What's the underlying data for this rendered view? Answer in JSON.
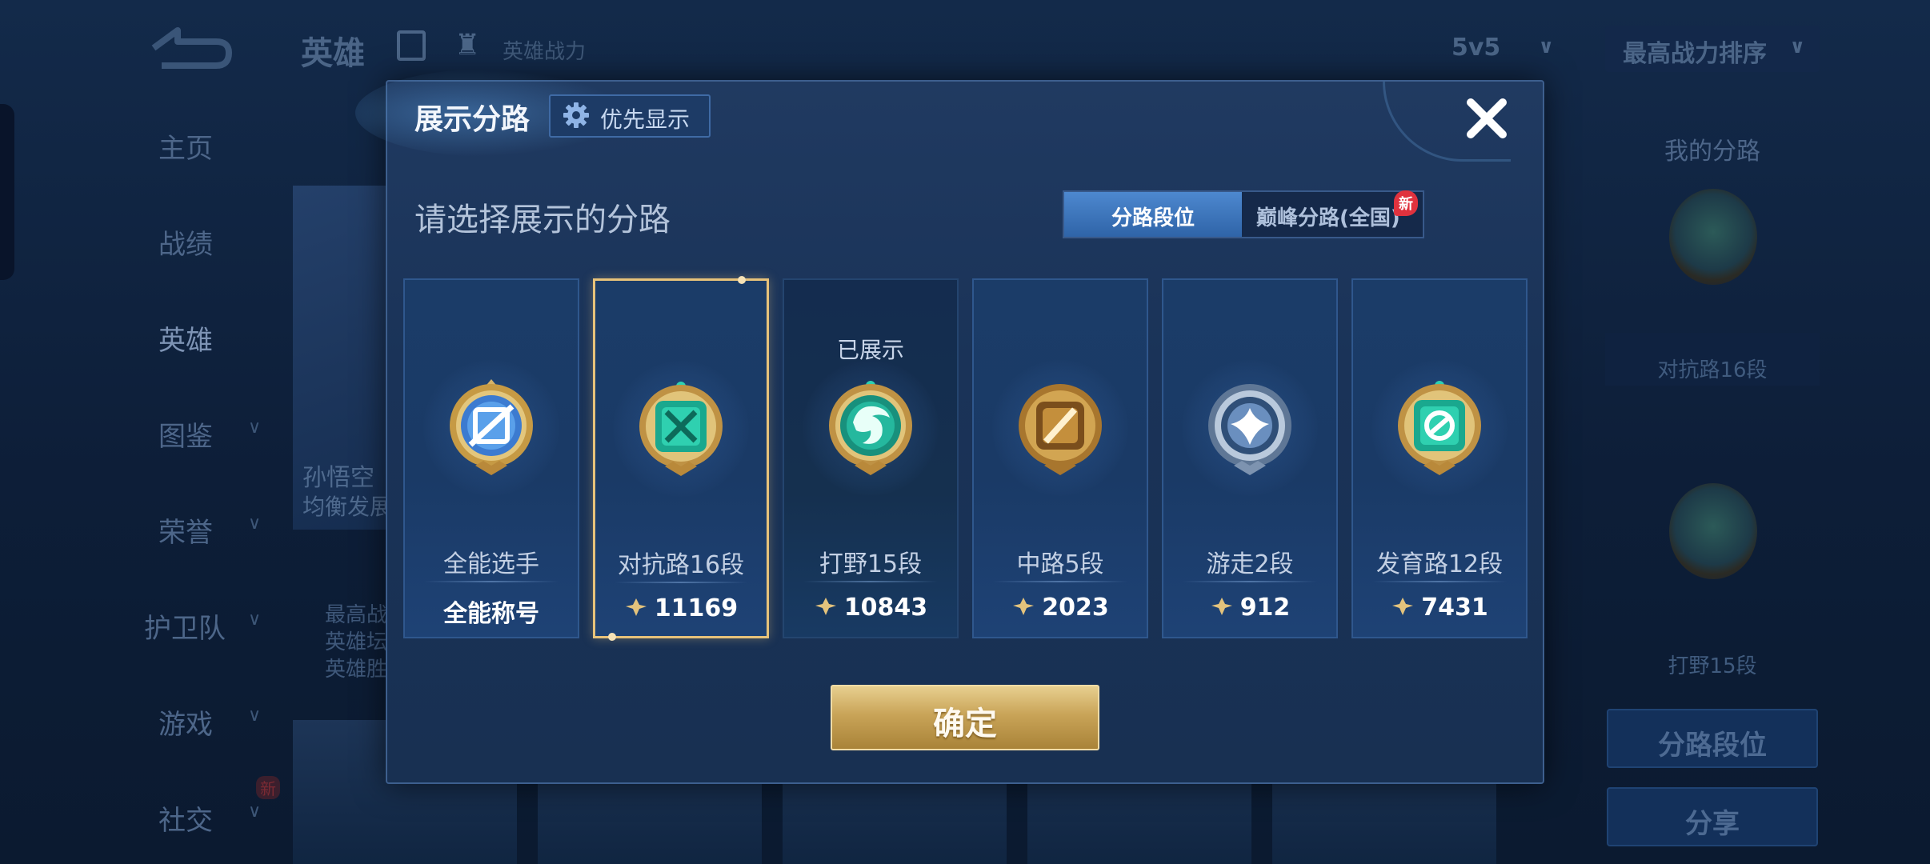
{
  "background": {
    "header": {
      "title": "英雄",
      "power_label": "英雄战力",
      "mode": "5v5",
      "sort": "最高战力排序"
    },
    "nav": [
      "主页",
      "战绩",
      "英雄",
      "图鉴",
      "荣誉",
      "护卫队",
      "游戏",
      "社交"
    ],
    "nav_active": "英雄",
    "nav_new_badge": "新",
    "hero_card": {
      "name": "孙悟空",
      "sub": "均衡发展",
      "stats": [
        "最高战",
        "英雄坛",
        "英雄胜"
      ]
    },
    "right_panel": {
      "title": "我的分路",
      "lane1": "对抗路16段",
      "lane2": "打野15段",
      "btn_rank": "分路段位",
      "btn_share": "分享"
    }
  },
  "modal": {
    "title": "展示分路",
    "priority_label": "优先显示",
    "subtitle": "请选择展示的分路",
    "tabs": [
      {
        "label": "分路段位",
        "active": true
      },
      {
        "label": "巅峰分路(全国)",
        "active": false,
        "badge": "新"
      }
    ],
    "cards": [
      {
        "name": "全能选手",
        "value": "全能称号",
        "has_power": false,
        "medal": "all-round-medal-icon",
        "shown": false,
        "selected": false
      },
      {
        "name": "对抗路16段",
        "value": "11169",
        "has_power": true,
        "medal": "clash-lane-medal-icon",
        "shown": false,
        "selected": true
      },
      {
        "name": "打野15段",
        "value": "10843",
        "has_power": true,
        "medal": "jungle-medal-icon",
        "shown": true,
        "selected": false,
        "shown_label": "已展示"
      },
      {
        "name": "中路5段",
        "value": "2023",
        "has_power": true,
        "medal": "mid-lane-medal-icon",
        "shown": false,
        "selected": false
      },
      {
        "name": "游走2段",
        "value": "912",
        "has_power": true,
        "medal": "roam-medal-icon",
        "shown": false,
        "selected": false
      },
      {
        "name": "发育路12段",
        "value": "7431",
        "has_power": true,
        "medal": "farm-lane-medal-icon",
        "shown": false,
        "selected": false
      }
    ],
    "confirm_label": "确定"
  },
  "colors": {
    "accent_gold": "#e7c27a",
    "tab_active": "#3f79bf",
    "badge_red": "#e0323e",
    "confirm_gold": "#c9a458"
  }
}
